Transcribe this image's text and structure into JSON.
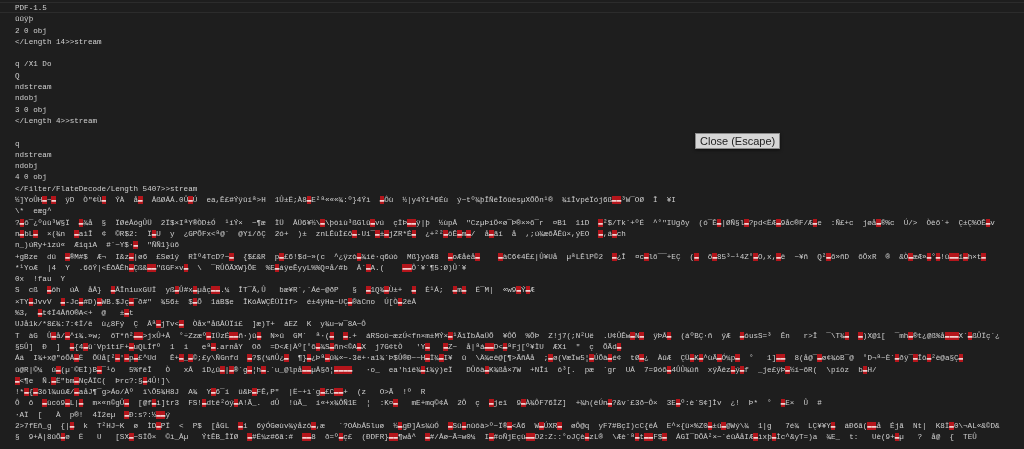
{
  "editor": {
    "lines": [
      {
        "kind": "text",
        "current": true,
        "text": "PDF-1.5"
      },
      {
        "kind": "text",
        "current": false,
        "text": "ûûÿþ"
      },
      {
        "kind": "text",
        "current": false,
        "text": "2 0 obj"
      },
      {
        "kind": "text",
        "current": false,
        "text": "</Length 14>>stream"
      },
      {
        "kind": "blank",
        "current": false
      },
      {
        "kind": "text",
        "current": false,
        "text": "q /X1 Do"
      },
      {
        "kind": "text",
        "current": false,
        "text": "Q"
      },
      {
        "kind": "text",
        "current": false,
        "text": "ndstream"
      },
      {
        "kind": "text",
        "current": false,
        "text": "ndobj"
      },
      {
        "kind": "text",
        "current": false,
        "text": "3 0 obj"
      },
      {
        "kind": "text",
        "current": false,
        "text": "</Length 4>>stream"
      },
      {
        "kind": "blank",
        "current": false
      },
      {
        "kind": "text",
        "current": false,
        "text": "q"
      },
      {
        "kind": "text",
        "current": false,
        "text": "ndstream"
      },
      {
        "kind": "text",
        "current": false,
        "text": "ndobj"
      },
      {
        "kind": "text",
        "current": false,
        "text": "4 0 obj"
      },
      {
        "kind": "text",
        "current": false,
        "text": "</Filter/FlateDecode/Length 5407>>stream"
      },
      {
        "kind": "text",
        "current": false,
        "text": "½]YoÛH▬~▬  ÿD  Ò\"¢Ù▬  ÝÀ  å▬  ÅßØÅÁ.0Û▬Ú  ea,Ê£#Ýÿûíª>H  1Û±Ë;À8▬E²ª«««¾:º}4Ýì  ▬Ôù  ½|y4Ýíª6Éù  ý~tº¾þÎÑéÎõûèsµXÕÕn¹®  ¾ïÎvpéÏój6ß▬▬³W¯OØ  Î  ¥I"
      },
      {
        "kind": "text",
        "current": false,
        "text": "\\*  eæg^"
      },
      {
        "kind": "text",
        "current": false,
        "text": "?▬ō¯¿ºúù³W§Ï  ▬¾å  §  ÏØéÅógÛÜ  2Ï$×IªY®ÒD±Ó  ¹íÝ×  ~¶æ  ÌÜ  ÅÜ6¥½\\▬\\þòìù³ßGlû▬vú  çÏÞ▬▬ÿ|þ  ½ùpÅ  \"CzµÞíÖ«ø¯Þ®×»õ¯r  ¤B1  1iD  ▬²$/Tk`+ºÉ  ^°\"IUgðy  (ó¯Ê▬|ØÑ§l▬?pd<ËÆ▬9åc®F/Æ▬e  :Ñ£+c  jøå▬®%c  Ú/>  Òèõ´+  Ç±Ç%OÊ▬v"
      },
      {
        "kind": "text",
        "current": false,
        "text": "n▬bL▬  ×(¾n  ▬aìÎ  ¢  ©R$2:  Ï▬U  y  ¿GPÕFx<ª@´  @Yï/ðÇ  2ó+  )±  znLÊùÌ£õ▬-Ui¯▬±▬jZR*É▬  ¿+²²▬ôÊ▬m▬/  å▬ãí  å  ,;ú¾æõÃÊû×,ýEO  ▬,á▬ch"
      },
      {
        "kind": "text",
        "current": false,
        "text": "n_)úRy+ìzú«  ÆiqìA  #´~Y$·▬  \"ÑÑ1}ùõ"
      },
      {
        "kind": "text",
        "current": false,
        "text": "+gBze  dü  ▬®M#$  Æ¬  I&z▬|ø6  £Sø1ý  RÌº4TcD?~▬  {$£&R  p▬£6!$d~»(c  ^¿ÿzò▬¾íë·q6úò  Mß}yóÆ8  ▬oÆåèå▬    ▬àC6¢4Ë£|Û¥Uå  µªLÊlP©2  ▬¿Î  ¤c▬lõ¯¯+EÇ  (▬  õ▬85³~¹4Z°▬O,x,▬ë  ~¥ñ  Q²▬õ»ñD  õÕxR  ®  &Ò▬æÆ»▬°▬!ü▬▬î▬h×t▬"
      },
      {
        "kind": "text",
        "current": false,
        "text": "*¹YoÆ  |4  Y  .6õÝ|<ÊðÅÊh▬Çß&▬▬\"ßGF×v▬  \\  ¯RÛÕÃXW}ÕE  %E▬áÿeÊyyL%%Q¤å/#b  Å`▬A.(    ▬▬Ô`¥´¶5:Ø)Û`¥"
      },
      {
        "kind": "text",
        "current": false,
        "text": "0x  !fau  Y"
      },
      {
        "kind": "text",
        "current": false,
        "text": "S  cß  ▬ôh  úÀ  åÅ}  ▬ÅÎniuxGUÏ  yß▬Û#x▬µåç▬▬.¼  ÎT¯Ã,Û   bæ¥R`,`Áé~@ðP   §  ▬1Q¾▬Ù±+  ▬  È¹Á;  ▬m▬  Ë¯M|  «w9▬Ý▬Æ"
      },
      {
        "kind": "text",
        "current": false,
        "text": "×TY▬JvvV  ▬-Jc▬#D)▬WB.$Jç▬¯ð#\"  ¾56±  $▬Õ  1áB$e  ÎKóÅWÇÊÜÏIf>  é±4ÿHa~UÇ▬®àCno  Ú[Ò▬2èÅ"
      },
      {
        "kind": "text",
        "current": false,
        "text": "%3,  ▬t¢Ï4ÅñO®A<+  @   ±▬t"
      },
      {
        "kind": "text",
        "current": false,
        "text": "UJå1k/*8£¾:7:¢Ï/ê  ù¿8Fý  Ç  Åª▬jTv<▬  Òåx\"åßÅÜÏí£  ]æ)T+  áEZ  K  y¾u~w¯8A~Ô"
      },
      {
        "kind": "text",
        "current": false,
        "text": "T  àG  Û▬å/▬^í¾.»w;  õT*ñ²▬▬>jxÛ+Å  °÷Zzæº▬IÜzÉ▬▬ñ·)û▬  N»û  GM´  ª·(▬  ▬.+  áRSoû~æzÚ<fn×m±MÝ×▬¹ÃïÏbÅaÜÕ  ¥ÔÕ  %ÕÞ  Z!j7(;N²Uë  .U¢ÛÊw▬N▬  ÿÞÅ▬  (áºBÇ·ñ  ÿÆ  ▬óusS=³  Ên   r>Î  ¯\\T¾▬  ▬)X@1[  ¯mh▬®t¿@ß%å▬▬▬X´▬ßÛÏç`¿"
      },
      {
        "kind": "text",
        "current": false,
        "text": "§5Û]  Ð  ]  ▬{4▬û`Vp1tíF+▬uQLÍfº  1  i   eª▬.arnåY  Oð  =D<Æ|Àº[°õ▬¾S▬ñn<©A▬X  j7G¢tÒ   'Y▬   ▬Z~  å|ªá▬▬D<▬ªFj[º¥ÌU  ÆXi  \"  ç  ÕÃd▬"
      },
      {
        "kind": "text",
        "current": false,
        "text": "Áá  I¾+x@\"óÕÅ▬Ë  ÕÜå[²▬'▬p▬£^Ud   Ê+▬_▬©;£y\\ÑGnfd  ▬?$(¼ñÛ¿▬  ¶}▬¿Þª▬û¾«~-3ë+·a1¾`Þ$Û®Ð~~H▬Ï¾▬I¥  û  \\Ä¾eê@[¶>ÃñÅå  ;▬ø(VæÏw5¦▬ÚÕà▬é¢  tØ▬¿  ÀûÆ  ÇÜ▬K▬^ùÃ▬Ó¼p▬  °   1]▬▬  8(å@¯▬ø¢¾òB¯@  °D¬ª~È´▬ðÿ¯▬Îô▬²è@a§Ç▬"
      },
      {
        "kind": "text",
        "current": false,
        "text": "û@R|©¼  ù▬(µ´©EÌ)B▬¯¹ö   5%fêÎ   Ò   xÅ  iD¿û▬|▬®`g▬¦h▬.`u_@lpå▬▬µÅ§ð¦▬▬▬▬   ·o_  ea'hië¾▬í¾ý)eÏ   DÛõà▬K¾ßå×7W  +NÎí  ô³[.  pæ  `gr  UÅ  7=9óõ▬4ÛÛ¾ûñ  xÿÃêz▬ý▬f  _je£ÿÞ▬½í~õR(  \\píòz  b▬H/"
      },
      {
        "kind": "text",
        "current": false,
        "text": "▬<¶e  Ñ.▬Ë\"bm▬NçÅÏC(  Þrc?:§▬4Û!]\\"
      },
      {
        "kind": "text",
        "current": false,
        "text": "!*▬{▬3ôl¾uûÆ/▬aåJ¶¯g>Áo/Àº  ï\\Õ5¾H8J  A¾  Y▬6¯í  ü&Þ▬FÊ,P\"  |Ë~+ì`g▬£C▬▬+  (z   O>Ã  !º  R"
      },
      {
        "kind": "text",
        "current": false,
        "text": "Ô  ō  ▬ùcò9▬L|▬  m×«n©gÛ▬  [@f▬ì]tr3  FS!▬dtê²óý▬A!Ã_.  dÛ  !ûÃ_  í«+x¾ÔÑ1E  ¦  :K¤▬   mE+mq©¢Å  2Ô  ç  ▬jeï  9▬À¾ÔF76ÏZ]  +¾h(ëÚn▬?&v`£3ð~Ô×  3E▬º:è`S¢]Ìv  ¿!  Þ*  °  ▬E×  Û  #"
      },
      {
        "kind": "text",
        "current": false,
        "text": "·AÏ  [   À  p®!  4Ï2eµ  ▬Ð:s?:½▬▬ý"
      },
      {
        "kind": "text",
        "current": false,
        "text": "2>7fEñ_g  {|▬  k  T²HJ~K  ø  ÌD▬PÏ  <  P$  [åGL  ▬i  6ýÓGøùv¾ýåzô▬,æ   `?OÁbÅ5luø  ½▬gÐ]Ås¾ùÓ  ▬Sü▬nûôà>º~Ï®▬<Å6  W▬ÚXR▬  øÔ@q  yF7#BçI)cC{ëÁ  E^×{ü×%Z0▬±ù▬@Wý\\¾  1|g   7é¾  LÇ¥¥Y▬  áÐ6ã(▬▬å  Éjã  Nt|  K8Ï▬0\\¬AL«&©D&"
      },
      {
        "kind": "text",
        "current": false,
        "text": "§  9+Ä|8ûÕ▬ø  Ë   U   [SX▬~SÏÕ×  ©ì_Åµ   ÝtÊB_ÎÏØ  ▬#Ë¼z#6ã:#  ▬▬8  ð=º▬ç£  (ÐDFR}▬▬¶wå^  ▬#/Åø~Ã=w0¼  I▬#oÑjEçù▬▬D2:Z::°oJÇè▬zL®  \\Æè´ª▬t▬▬F$▬  ÁGÏ¯DÕÅ²×~`éûÅåIÆ▬ìxþ▬Ìc^&yT=)a  ¾E_  t:   Uè(9+▬µ   ?  å@  {  TEÛ"
      }
    ]
  },
  "close_button": {
    "label": "Close (Escape)"
  }
}
